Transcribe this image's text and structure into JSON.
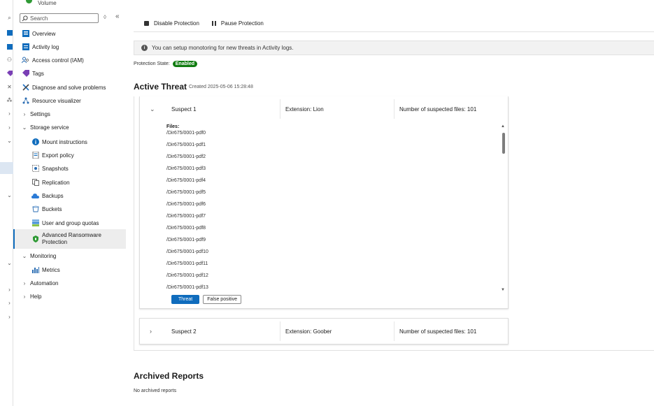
{
  "header": {
    "resource_type": "Volume"
  },
  "search": {
    "placeholder": "Search"
  },
  "sidebar": {
    "items": [
      {
        "label": "Overview",
        "icon": "overview-icon"
      },
      {
        "label": "Activity log",
        "icon": "activity-log-icon"
      },
      {
        "label": "Access control (IAM)",
        "icon": "iam-icon"
      },
      {
        "label": "Tags",
        "icon": "tag-icon"
      },
      {
        "label": "Diagnose and solve problems",
        "icon": "wrench-icon"
      },
      {
        "label": "Resource visualizer",
        "icon": "visualizer-icon"
      },
      {
        "label": "Settings",
        "group": true,
        "expanded": false
      },
      {
        "label": "Storage service",
        "group": true,
        "expanded": true
      },
      {
        "label": "Mount instructions",
        "icon": "info-icon",
        "child": true
      },
      {
        "label": "Export policy",
        "icon": "export-policy-icon",
        "child": true
      },
      {
        "label": "Snapshots",
        "icon": "snapshot-icon",
        "child": true
      },
      {
        "label": "Replication",
        "icon": "replication-icon",
        "child": true
      },
      {
        "label": "Backups",
        "icon": "cloud-backup-icon",
        "child": true
      },
      {
        "label": "Buckets",
        "icon": "bucket-icon",
        "child": true
      },
      {
        "label": "User and group quotas",
        "icon": "quota-icon",
        "child": true
      },
      {
        "label_line1": "Advanced Ransomware",
        "label_line2": "Protection",
        "icon": "shield-icon",
        "child": true,
        "selected": true
      },
      {
        "label": "Monitoring",
        "group": true,
        "expanded": true
      },
      {
        "label": "Metrics",
        "icon": "metrics-icon",
        "child": true
      },
      {
        "label": "Automation",
        "group": true,
        "expanded": false
      },
      {
        "label": "Help",
        "group": true,
        "expanded": false
      }
    ]
  },
  "toolbar": {
    "disable_label": "Disable Protection",
    "pause_label": "Pause Protection"
  },
  "info_message": "You can setup monotoring for new threats in Activity logs.",
  "protection": {
    "label": "Protection State:",
    "state": "Enabled",
    "state_color": "#107c10"
  },
  "active_threat": {
    "title": "Active Threat",
    "created": "Created 2025-05-06 15:28:48",
    "suspects": [
      {
        "name": "Suspect 1",
        "extension": "Extension: Lion",
        "count": "Number of suspected files: 101",
        "expanded": true,
        "files_label": "Files:",
        "files": [
          "/Dir675/0001-pdf0",
          "/Dir675/0001-pdf1",
          "/Dir675/0001-pdf2",
          "/Dir675/0001-pdf3",
          "/Dir675/0001-pdf4",
          "/Dir675/0001-pdf5",
          "/Dir675/0001-pdf6",
          "/Dir675/0001-pdf7",
          "/Dir675/0001-pdf8",
          "/Dir675/0001-pdf9",
          "/Dir675/0001-pdf10",
          "/Dir675/0001-pdf11",
          "/Dir675/0001-pdf12",
          "/Dir675/0001-pdf13"
        ],
        "threat_label": "Threat",
        "false_positive_label": "False positive"
      },
      {
        "name": "Suspect 2",
        "extension": "Extension: Goober",
        "count": "Number of suspected files: 101",
        "expanded": false
      }
    ]
  },
  "archived": {
    "title": "Archived Reports",
    "empty_text": "No archived reports"
  },
  "colors": {
    "accent": "#0f6cbd",
    "success": "#107c10"
  }
}
